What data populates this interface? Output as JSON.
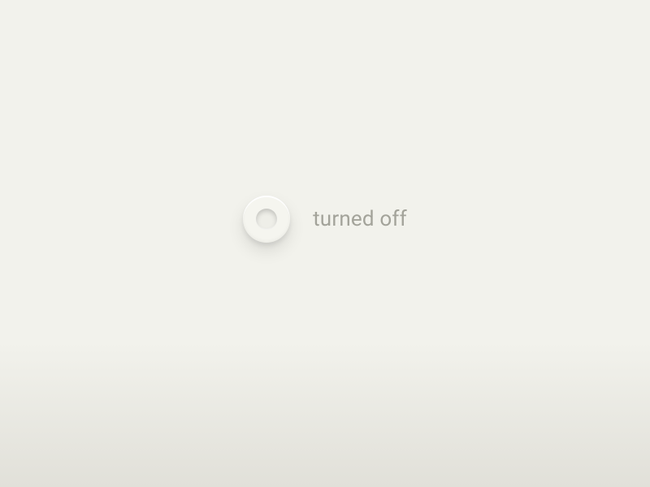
{
  "toggle": {
    "state_label": "turned off",
    "state": "off"
  }
}
